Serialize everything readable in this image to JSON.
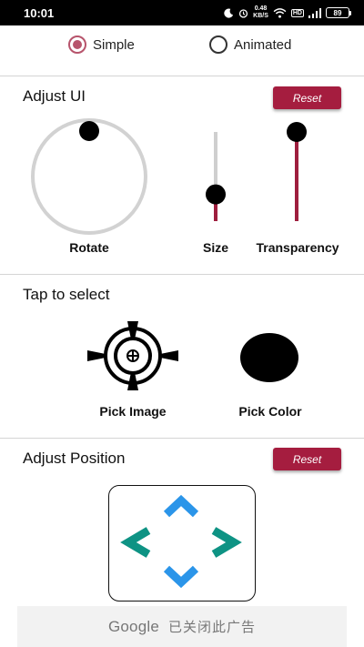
{
  "status_bar": {
    "time": "10:01",
    "speed_value": "0.48",
    "speed_unit": "KB/S",
    "network_badge": "HD",
    "battery": "89"
  },
  "mode": {
    "options": [
      {
        "label": "Simple",
        "selected": true
      },
      {
        "label": "Animated",
        "selected": false
      }
    ],
    "accent_color": "#b7546c"
  },
  "adjust_ui": {
    "title": "Adjust UI",
    "reset_label": "Reset",
    "rotate_label": "Rotate",
    "size_label": "Size",
    "transparency_label": "Transparency",
    "size_level": 0.3,
    "transparency_level": 1.0,
    "track_active_color": "#9e1e3e",
    "track_inactive_color": "#cfcfcf"
  },
  "tap_to_select": {
    "title": "Tap to select",
    "pick_image_label": "Pick Image",
    "pick_color_label": "Pick Color",
    "picked_color": "#000000"
  },
  "adjust_position": {
    "title": "Adjust Position",
    "reset_label": "Reset",
    "arrow_up_color": "#2b95e9",
    "arrow_side_color": "#0e9384"
  },
  "ad": {
    "brand": "Google",
    "message": "已关闭此广告"
  },
  "button_color": "#a51d3f"
}
